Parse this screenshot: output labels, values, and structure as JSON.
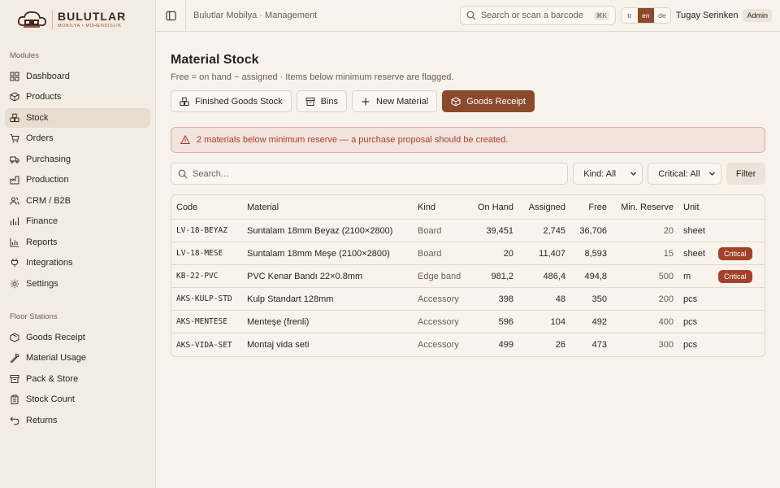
{
  "brand": {
    "name": "BULUTLAR",
    "tagline": "MOBİLYA • MÜHENDİSLİK"
  },
  "sidebar": {
    "modules_label": "Modules",
    "modules": [
      {
        "label": "Dashboard",
        "icon": "dashboard-icon"
      },
      {
        "label": "Products",
        "icon": "box-icon"
      },
      {
        "label": "Stock",
        "icon": "boxes-icon",
        "active": true
      },
      {
        "label": "Orders",
        "icon": "cart-icon"
      },
      {
        "label": "Purchasing",
        "icon": "truck-icon"
      },
      {
        "label": "Production",
        "icon": "factory-icon"
      },
      {
        "label": "CRM / B2B",
        "icon": "users-icon"
      },
      {
        "label": "Finance",
        "icon": "finance-icon"
      },
      {
        "label": "Reports",
        "icon": "chart-icon"
      },
      {
        "label": "Integrations",
        "icon": "plug-icon"
      },
      {
        "label": "Settings",
        "icon": "gear-icon"
      }
    ],
    "floor_label": "Floor Stations",
    "floor": [
      {
        "label": "Goods Receipt",
        "icon": "package-icon"
      },
      {
        "label": "Material Usage",
        "icon": "wrench-icon"
      },
      {
        "label": "Pack & Store",
        "icon": "archive-icon"
      },
      {
        "label": "Stock Count",
        "icon": "clipboard-icon"
      },
      {
        "label": "Returns",
        "icon": "return-icon"
      }
    ]
  },
  "topbar": {
    "breadcrumb": "Bulutlar Mobilya · Management",
    "search_placeholder": "Search or scan a barcode",
    "shortcut": "⌘K",
    "languages": [
      "tr",
      "en",
      "de"
    ],
    "active_language": "en",
    "user": "Tugay Serinken",
    "role": "Admin"
  },
  "page": {
    "title": "Material Stock",
    "subtitle": "Free = on hand − assigned · Items below minimum reserve are flagged.",
    "buttons": {
      "finished": "Finished Goods Stock",
      "bins": "Bins",
      "new_material": "New Material",
      "goods_receipt": "Goods Receipt"
    },
    "alert": "2 materials below minimum reserve — a purchase proposal should be created.",
    "filters": {
      "search_placeholder": "Search...",
      "kind": "Kind: All",
      "critical": "Critical: All",
      "filter_button": "Filter"
    }
  },
  "table": {
    "headers": [
      "Code",
      "Material",
      "Kind",
      "On Hand",
      "Assigned",
      "Free",
      "Min. Reserve",
      "Unit",
      ""
    ],
    "rows": [
      {
        "code": "LV-18-BEYAZ",
        "material": "Suntalam 18mm Beyaz (2100×2800)",
        "kind": "Board",
        "on_hand": "39,451",
        "assigned": "2,745",
        "free": "36,706",
        "min": "20",
        "unit": "sheet",
        "status": ""
      },
      {
        "code": "LV-18-MESE",
        "material": "Suntalam 18mm Meşe (2100×2800)",
        "kind": "Board",
        "on_hand": "20",
        "assigned": "11,407",
        "free": "8,593",
        "min": "15",
        "unit": "sheet",
        "status": "Critical"
      },
      {
        "code": "KB-22-PVC",
        "material": "PVC Kenar Bandı 22×0.8mm",
        "kind": "Edge band",
        "on_hand": "981,2",
        "assigned": "486,4",
        "free": "494,8",
        "min": "500",
        "unit": "m",
        "status": "Critical"
      },
      {
        "code": "AKS-KULP-STD",
        "material": "Kulp Standart 128mm",
        "kind": "Accessory",
        "on_hand": "398",
        "assigned": "48",
        "free": "350",
        "min": "200",
        "unit": "pcs",
        "status": ""
      },
      {
        "code": "AKS-MENTESE",
        "material": "Menteşe (frenli)",
        "kind": "Accessory",
        "on_hand": "596",
        "assigned": "104",
        "free": "492",
        "min": "400",
        "unit": "pcs",
        "status": ""
      },
      {
        "code": "AKS-VIDA-SET",
        "material": "Montaj vida seti",
        "kind": "Accessory",
        "on_hand": "499",
        "assigned": "26",
        "free": "473",
        "min": "300",
        "unit": "pcs",
        "status": ""
      }
    ]
  },
  "colors": {
    "accent": "#8b4a2b",
    "critical": "#a5402b",
    "background": "#f7f2ec"
  }
}
